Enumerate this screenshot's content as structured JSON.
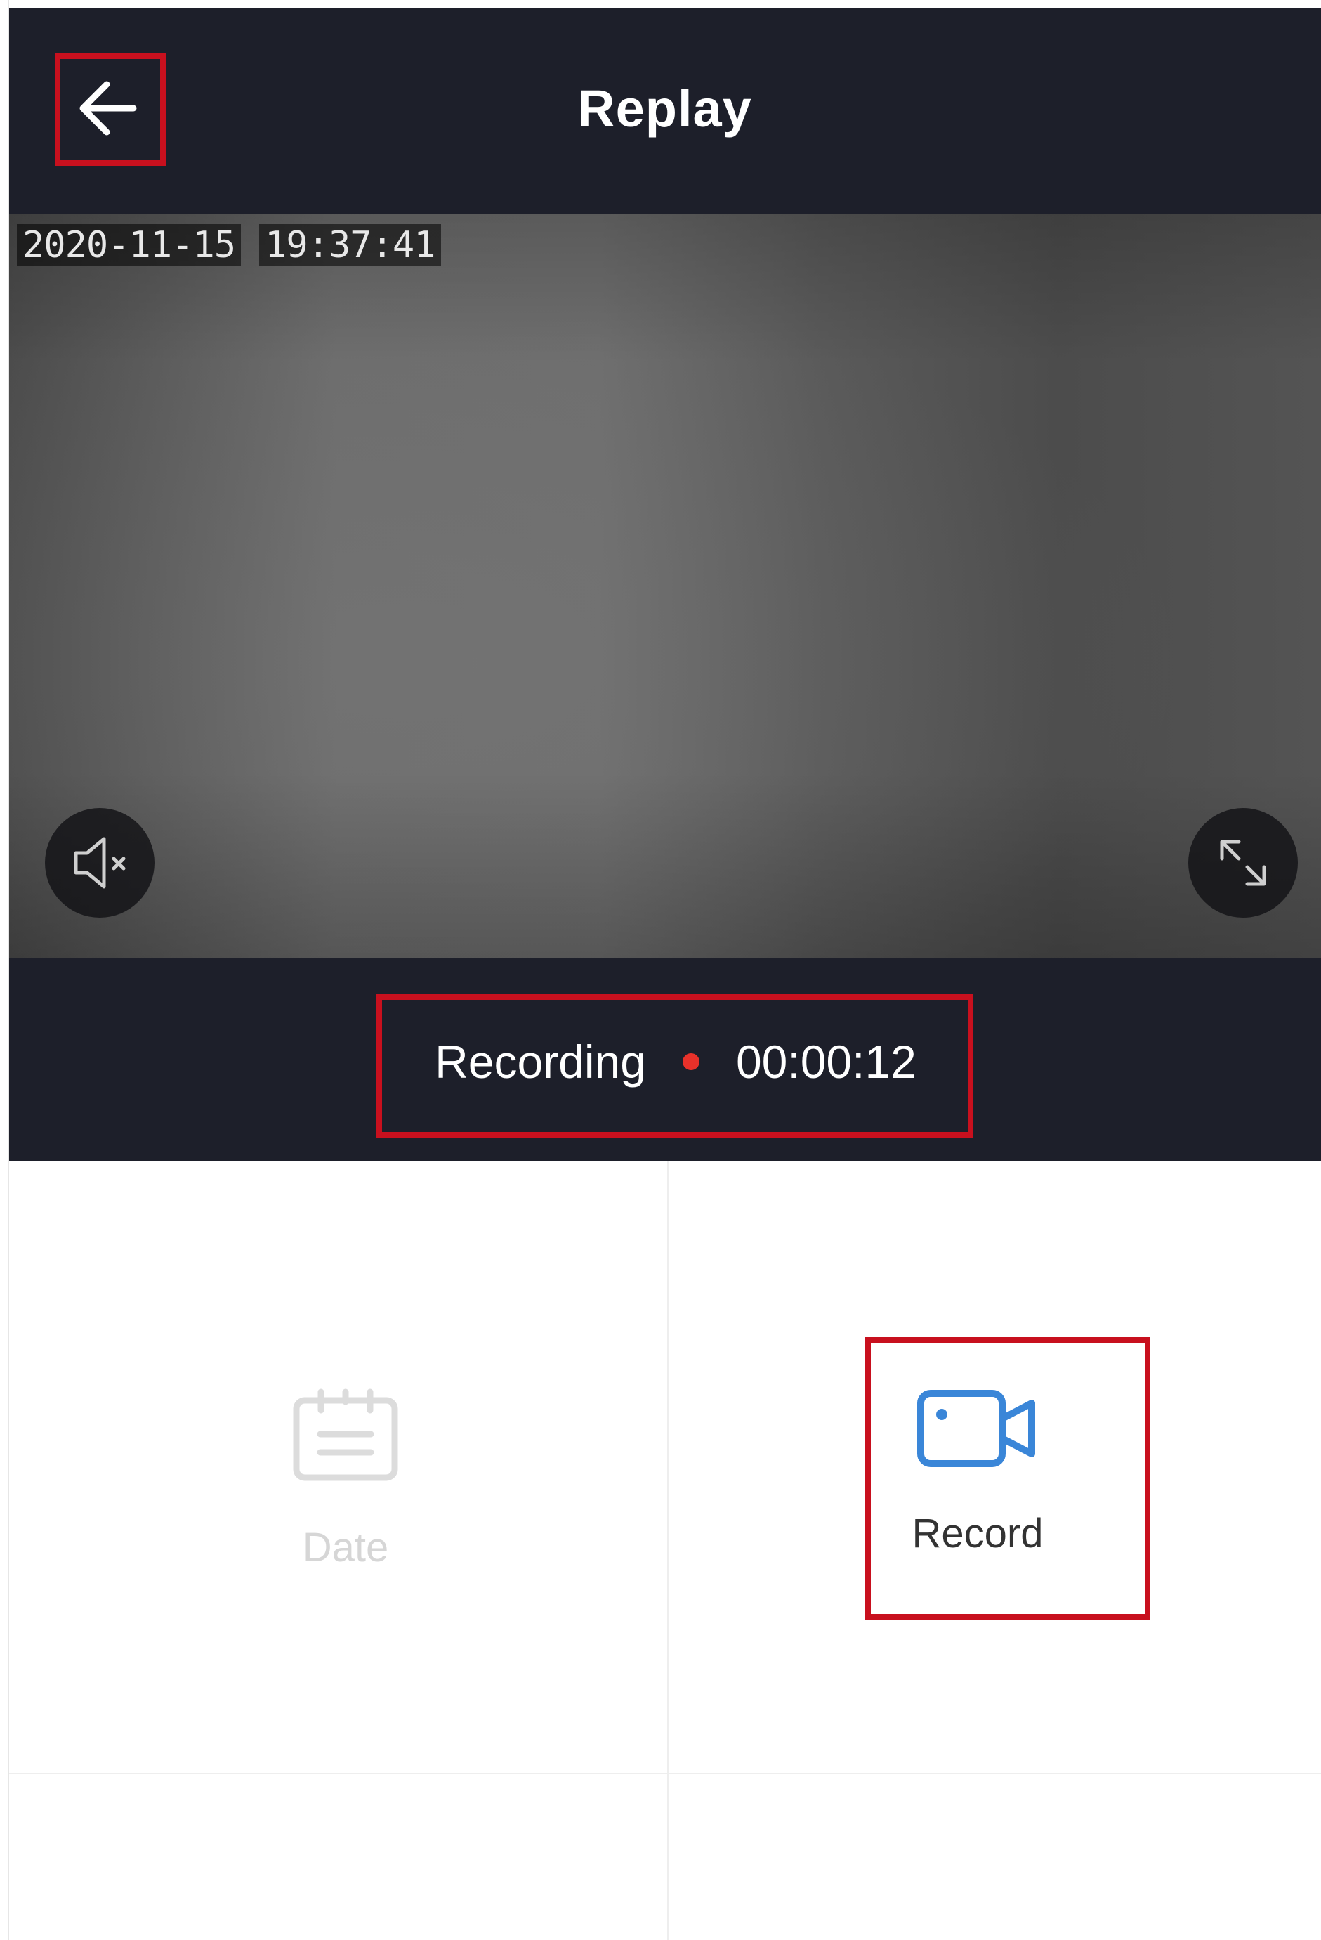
{
  "header": {
    "title": "Replay",
    "back_icon": "arrow-left-icon"
  },
  "video": {
    "date": "2020-11-15",
    "time": "19:37:41",
    "mute_icon": "speaker-muted-icon",
    "fullscreen_icon": "expand-icon"
  },
  "recording": {
    "label": "Recording",
    "timer": "00:00:12",
    "dot_color": "#e8312a"
  },
  "actions": [
    {
      "label": "Date",
      "icon": "calendar-icon",
      "enabled": false,
      "color": "#d6d6d6"
    },
    {
      "label": "Record",
      "icon": "video-camera-icon",
      "enabled": true,
      "color": "#3a86d8"
    }
  ],
  "colors": {
    "header_bg": "#1d1f2a",
    "annotation_red": "#c8101e",
    "accent_blue": "#3a86d8"
  }
}
